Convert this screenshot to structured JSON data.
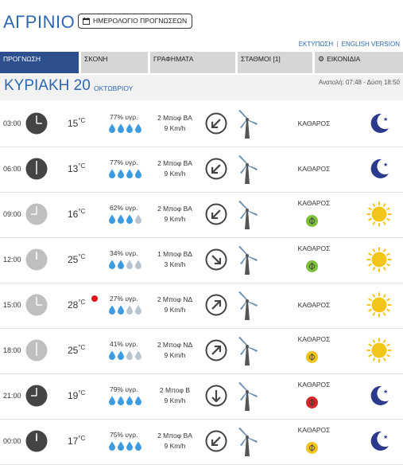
{
  "header": {
    "city": "ΑΓΡΙΝΙΟ",
    "calendar_button": "ΗΜΕΡΟΛΟΓΙΟ ΠΡΟΓΝΩΣΕΩΝ",
    "print_link": "ΕΚΤΥΠΩΣΗ",
    "separator": "|",
    "english_link": "ENGLISH VERSION"
  },
  "tabs": [
    {
      "label": "ΠΡΟΓΝΩΣΗ",
      "active": true
    },
    {
      "label": "ΣΚΟΝΗ",
      "active": false
    },
    {
      "label": "ΓΡΑΦΗΜΑΤΑ",
      "active": false
    },
    {
      "label": "ΣΤΑΘΜΟΙ [1]",
      "active": false
    },
    {
      "label": "ΕΙΚΟΝΙΔΙΑ",
      "active": false
    }
  ],
  "day": {
    "name": "ΚΥΡΙΑΚΗ 20",
    "month": "ΟΚΤΩΒΡΙΟΥ",
    "sun_times": "Ανατολή: 07:48 - Δύση 18:50"
  },
  "rows": [
    {
      "time": "03:00",
      "night": true,
      "temp": "15",
      "unit": "°C",
      "humidity": "77% υγρ.",
      "drops": 4,
      "wind_bf": "2 Μποφ ΒΑ",
      "wind_kmh": "9 Km/h",
      "wind_arrow": "sw",
      "condition": "ΚΑΘΑΡΟΣ",
      "air_quality": null,
      "icon": "moon",
      "hot": false
    },
    {
      "time": "06:00",
      "night": true,
      "temp": "13",
      "unit": "°C",
      "humidity": "77% υγρ.",
      "drops": 4,
      "wind_bf": "2 Μποφ ΒΑ",
      "wind_kmh": "9 Km/h",
      "wind_arrow": "sw",
      "condition": "ΚΑΘΑΡΟΣ",
      "air_quality": null,
      "icon": "moon",
      "hot": false
    },
    {
      "time": "09:00",
      "night": false,
      "temp": "16",
      "unit": "°C",
      "humidity": "62% υγρ.",
      "drops": 3,
      "wind_bf": "2 Μποφ ΒΑ",
      "wind_kmh": "9 Km/h",
      "wind_arrow": "sw",
      "condition": "ΚΑΘΑΡΟΣ",
      "air_quality": "#7bbf3a",
      "icon": "sun",
      "hot": false
    },
    {
      "time": "12:00",
      "night": false,
      "temp": "25",
      "unit": "°C",
      "humidity": "34% υγρ.",
      "drops": 2,
      "wind_bf": "1 Μποφ ΒΔ",
      "wind_kmh": "3 Km/h",
      "wind_arrow": "se",
      "condition": "ΚΑΘΑΡΟΣ",
      "air_quality": "#7bbf3a",
      "icon": "sun",
      "hot": false
    },
    {
      "time": "15:00",
      "night": false,
      "temp": "28",
      "unit": "°C",
      "humidity": "27% υγρ.",
      "drops": 2,
      "wind_bf": "2 Μποφ ΝΔ",
      "wind_kmh": "9 Km/h",
      "wind_arrow": "ne",
      "condition": "ΚΑΘΑΡΟΣ",
      "air_quality": null,
      "icon": "sun",
      "hot": true
    },
    {
      "time": "18:00",
      "night": false,
      "temp": "25",
      "unit": "°C",
      "humidity": "41% υγρ.",
      "drops": 2,
      "wind_bf": "2 Μποφ ΝΔ",
      "wind_kmh": "9 Km/h",
      "wind_arrow": "ne",
      "condition": "ΚΑΘΑΡΟΣ",
      "air_quality": "#f0c419",
      "icon": "sun",
      "hot": false
    },
    {
      "time": "21:00",
      "night": true,
      "temp": "19",
      "unit": "°C",
      "humidity": "79% υγρ.",
      "drops": 4,
      "wind_bf": "2 Μποφ Β",
      "wind_kmh": "9 Km/h",
      "wind_arrow": "s",
      "condition": "ΚΑΘΑΡΟΣ",
      "air_quality": "#d9262b",
      "icon": "moon",
      "hot": false
    },
    {
      "time": "00:00",
      "night": true,
      "temp": "17",
      "unit": "°C",
      "humidity": "75% υγρ.",
      "drops": 4,
      "wind_bf": "2 Μποφ ΒΑ",
      "wind_kmh": "9 Km/h",
      "wind_arrow": "sw",
      "condition": "ΚΑΘΑΡΟΣ",
      "air_quality": "#f0c419",
      "icon": "moon",
      "hot": false
    }
  ],
  "colors": {
    "accent": "#2d68b0",
    "tab_active": "#2d4f8e",
    "tab_inactive": "#d6d6d6",
    "drop_full": "#3d9be0",
    "drop_empty": "#b8c4cf",
    "moon": "#2c3a8c",
    "sun": "#f2c518"
  }
}
